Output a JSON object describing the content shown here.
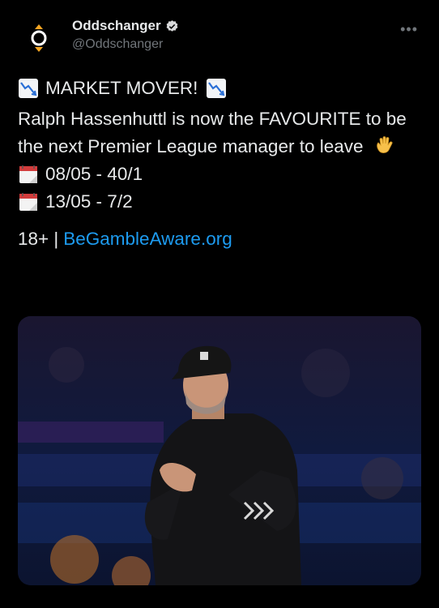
{
  "account": {
    "display_name": "Oddschanger",
    "handle": "@Oddschanger",
    "avatar_icon": "oddschanger-logo-icon",
    "verified_icon": "verified-badge-icon",
    "more_label": "•••"
  },
  "tweet": {
    "headline": "MARKET MOVER!",
    "headline_icon": "chart-decreasing-icon",
    "body": "Ralph Hassenhuttl is now the FAVOURITE to be the next Premier League manager to leave",
    "body_emoji": "waving-hand-icon",
    "odds": [
      {
        "icon": "calendar-icon",
        "text": "08/05 - 40/1"
      },
      {
        "icon": "calendar-icon",
        "text": "13/05 - 7/2"
      }
    ],
    "footer_prefix": "18+ |",
    "footer_link": "BeGambleAware.org"
  },
  "media": {
    "alt": "photo of a manager applauding in a stadium",
    "colors": {
      "background": "#0a0d1e",
      "jacket": "#141416",
      "cap": "#151515"
    }
  },
  "colors": {
    "background": "#000000",
    "text": "#e7e9ea",
    "muted": "#71767b",
    "link": "#1d9bf0",
    "verified": "#1d9bf0"
  }
}
